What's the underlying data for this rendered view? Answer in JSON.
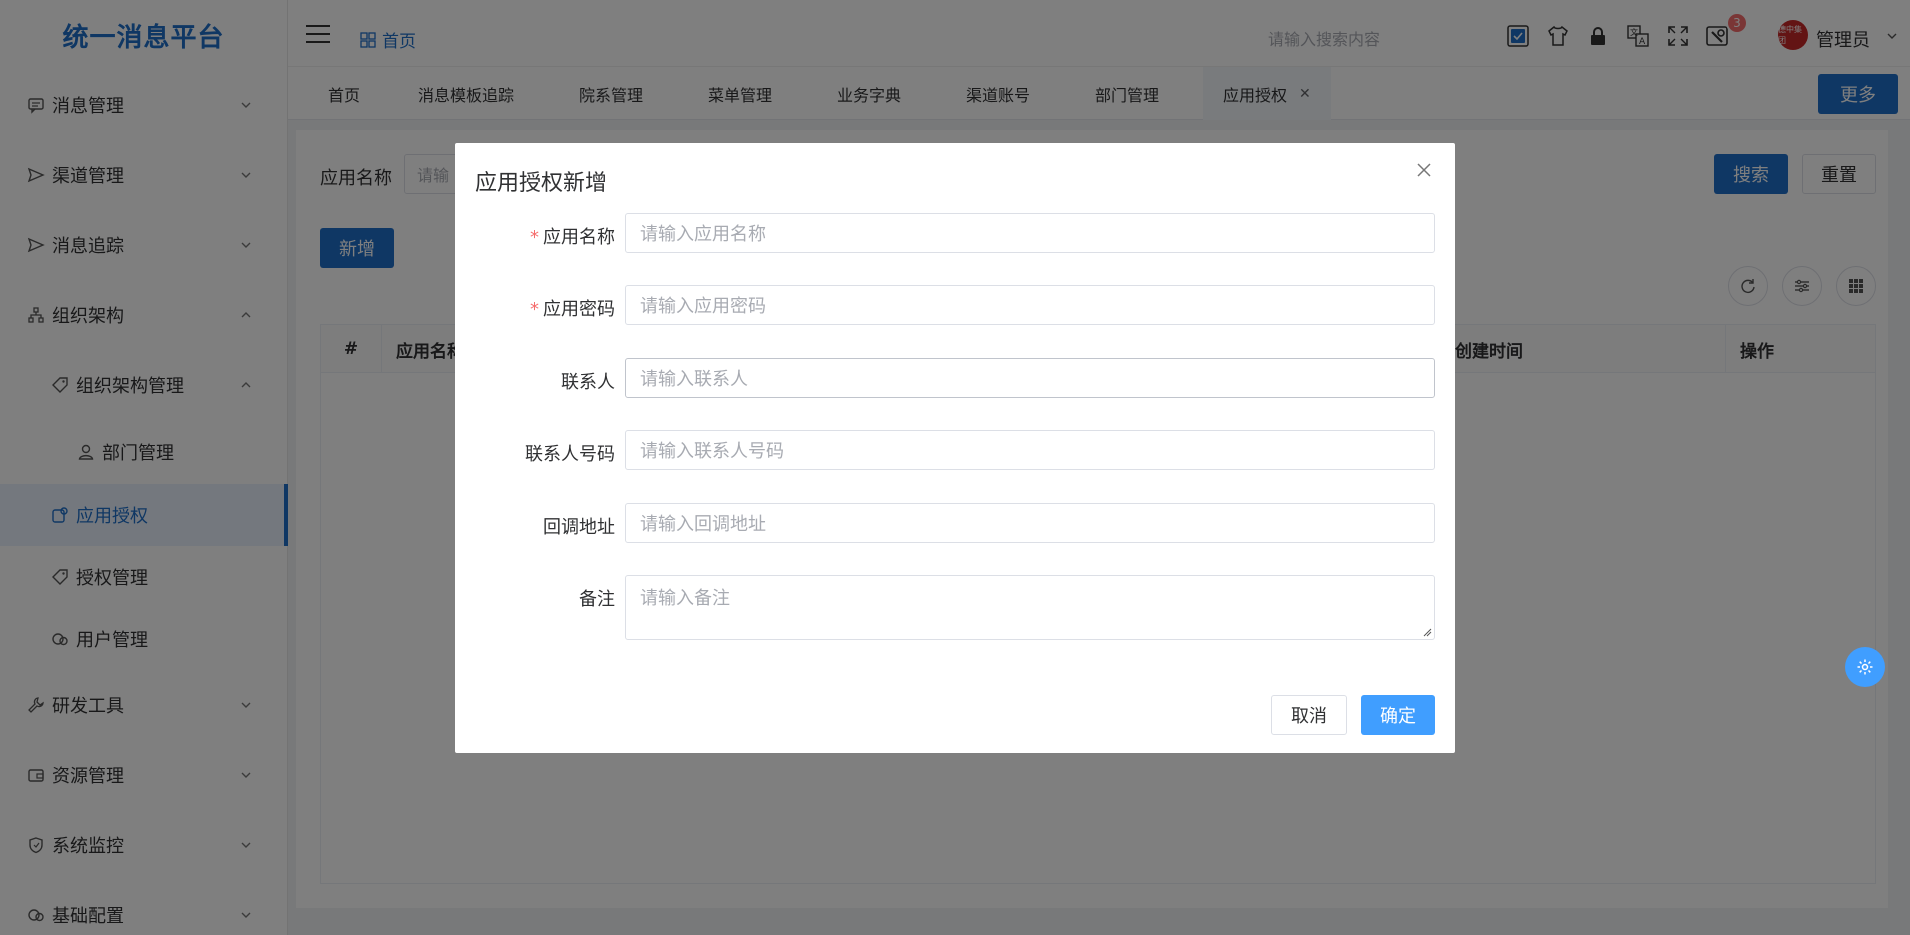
{
  "app": {
    "title": "统一消息平台"
  },
  "sidebar": {
    "items": [
      {
        "label": "消息管理"
      },
      {
        "label": "渠道管理"
      },
      {
        "label": "消息追踪"
      },
      {
        "label": "组织架构"
      },
      {
        "label": "组织架构管理"
      },
      {
        "label": "部门管理"
      },
      {
        "label": "应用授权"
      },
      {
        "label": "授权管理"
      },
      {
        "label": "用户管理"
      },
      {
        "label": "研发工具"
      },
      {
        "label": "资源管理"
      },
      {
        "label": "系统监控"
      },
      {
        "label": "基础配置"
      }
    ]
  },
  "header": {
    "breadcrumb": "首页",
    "search_placeholder": "请输入搜索内容",
    "notification_count": "3",
    "username": "管理员",
    "avatar_text": "德中集团"
  },
  "tabs": {
    "items": [
      {
        "label": "首页"
      },
      {
        "label": "消息模板追踪"
      },
      {
        "label": "院系管理"
      },
      {
        "label": "菜单管理"
      },
      {
        "label": "业务字典"
      },
      {
        "label": "渠道账号"
      },
      {
        "label": "部门管理"
      },
      {
        "label": "应用授权"
      }
    ],
    "more_label": "更多"
  },
  "main": {
    "filter_label": "应用名称",
    "filter_placeholder": "请输",
    "search_label": "搜索",
    "reset_label": "重置",
    "add_label": "新增",
    "table_headers": [
      "#",
      "应用名称",
      "创建时间",
      "操作"
    ]
  },
  "dialog": {
    "title": "应用授权新增",
    "fields": [
      {
        "label": "应用名称",
        "placeholder": "请输入应用名称",
        "required": true
      },
      {
        "label": "应用密码",
        "placeholder": "请输入应用密码",
        "required": true
      },
      {
        "label": "联系人",
        "placeholder": "请输入联系人",
        "required": false
      },
      {
        "label": "联系人号码",
        "placeholder": "请输入联系人号码",
        "required": false
      },
      {
        "label": "回调地址",
        "placeholder": "请输入回调地址",
        "required": false
      },
      {
        "label": "备注",
        "placeholder": "请输入备注",
        "required": false
      }
    ],
    "required_mark": "*",
    "cancel_label": "取消",
    "confirm_label": "确定"
  },
  "colors": {
    "brand": "#1f6fc9",
    "primary": "#409eff",
    "danger": "#f56c6c"
  }
}
